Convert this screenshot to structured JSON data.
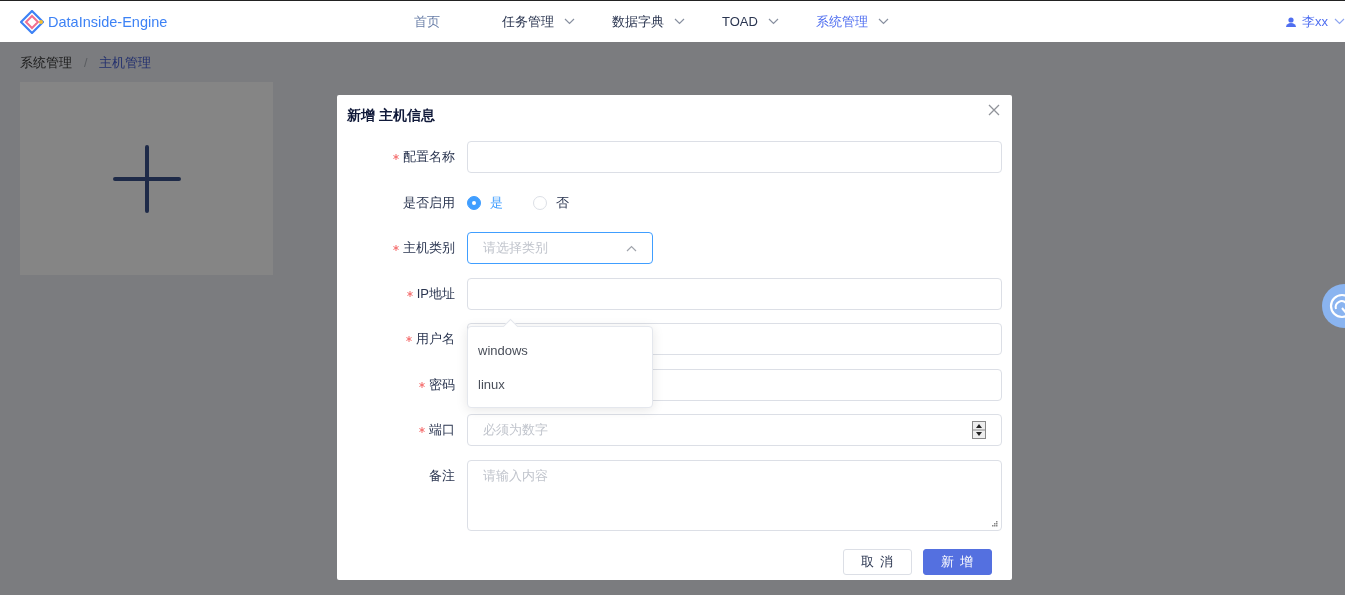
{
  "header": {
    "logo": "DataInside-Engine",
    "nav": [
      {
        "label": "首页",
        "kind": "link",
        "selected": false,
        "dropdown": false
      },
      {
        "label": "任务管理",
        "kind": "menu",
        "selected": false,
        "dropdown": true
      },
      {
        "label": "数据字典",
        "kind": "menu",
        "selected": false,
        "dropdown": true
      },
      {
        "label": "TOAD",
        "kind": "menu",
        "selected": false,
        "dropdown": true
      },
      {
        "label": "系统管理",
        "kind": "menu",
        "selected": true,
        "dropdown": true
      }
    ],
    "user": "李xx"
  },
  "breadcrumb": [
    {
      "label": "系统管理",
      "selected": false
    },
    {
      "label": "主机管理",
      "selected": true
    }
  ],
  "separator": "/",
  "dialog": {
    "title": "新增 主机信息",
    "fields": [
      {
        "label": "配置名称",
        "required": true,
        "kind": "input"
      },
      {
        "label": "是否启用",
        "required": false,
        "kind": "radio",
        "options": [
          {
            "label": "是",
            "selected": true
          },
          {
            "label": "否",
            "selected": false
          }
        ]
      },
      {
        "label": "主机类别",
        "required": true,
        "kind": "select",
        "placeholder": "请选择类别",
        "expanded": true,
        "options": [
          {
            "label": "windows"
          },
          {
            "label": "linux"
          }
        ]
      },
      {
        "label": "IP地址",
        "required": true,
        "kind": "input"
      },
      {
        "label": "用户名",
        "required": true,
        "kind": "input"
      },
      {
        "label": "密码",
        "required": true,
        "kind": "input"
      },
      {
        "label": "端口",
        "required": true,
        "kind": "number",
        "placeholder": "必须为数字"
      },
      {
        "label": "备注",
        "required": false,
        "kind": "textarea",
        "placeholder": "请输入内容"
      }
    ],
    "buttons": [
      {
        "label": "取 消",
        "kind": "secondary"
      },
      {
        "label": "新 增",
        "kind": "primary"
      }
    ]
  }
}
